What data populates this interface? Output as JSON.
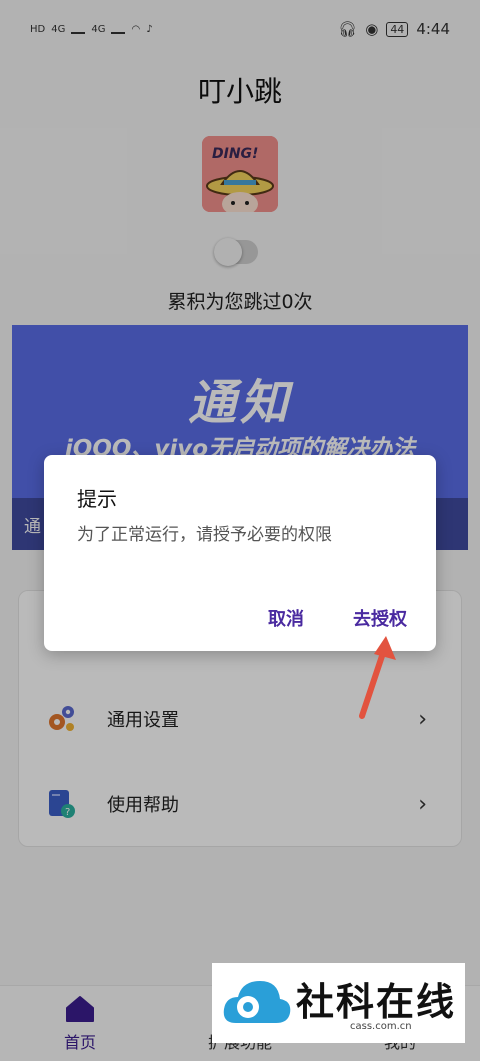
{
  "status_bar": {
    "time": "4:44",
    "battery": "44",
    "left_labels": [
      "HD",
      "4G",
      "4G"
    ]
  },
  "app": {
    "title": "叮小跳"
  },
  "logo": {
    "text": "DING!"
  },
  "toggle": {
    "enabled": false
  },
  "counter_text": "累积为您跳过0次",
  "banner": {
    "title": "通知",
    "subtitle": "iQOO、vivo无启动项的解决办法",
    "strip_text": "通"
  },
  "menu": {
    "items": [
      {
        "label": "通用设置",
        "icon": "gear-icon"
      },
      {
        "label": "使用帮助",
        "icon": "help-book-icon"
      }
    ]
  },
  "bottom_nav": {
    "home": "首页",
    "extensions": "扩展功能",
    "mine": "我的"
  },
  "dialog": {
    "title": "提示",
    "message": "为了正常运行，请授予必要的权限",
    "cancel": "取消",
    "confirm": "去授权"
  },
  "watermark": {
    "text": "社科在线",
    "url": "cass.com.cn"
  },
  "colors": {
    "accent": "#4a2aa0",
    "banner": "#5a6de6",
    "arrow": "#e2533f"
  }
}
